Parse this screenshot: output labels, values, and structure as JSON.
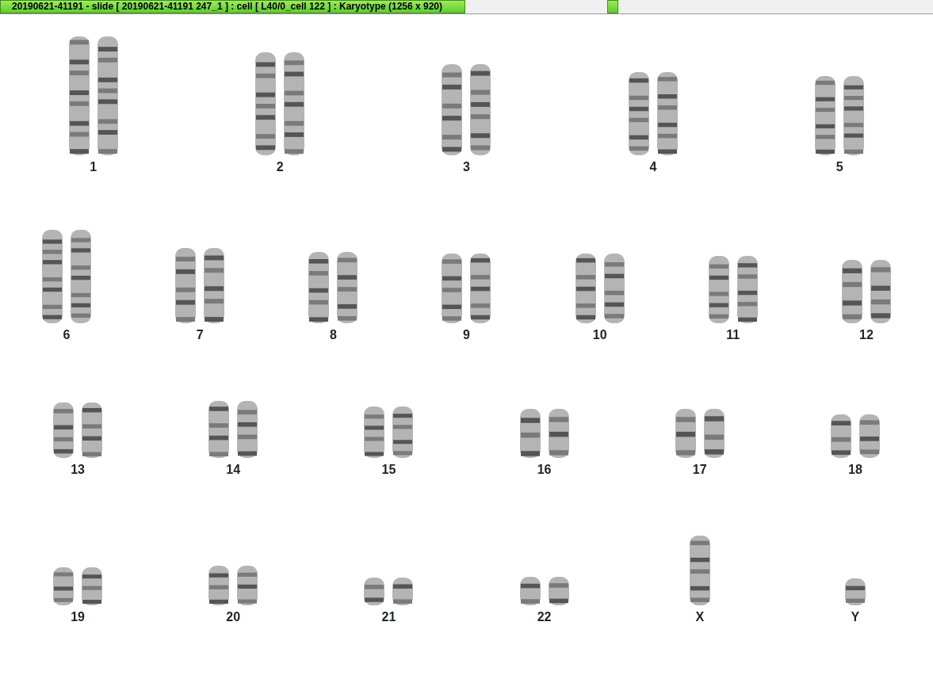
{
  "title_bar": {
    "title": "20190621-41191 - slide [ 20190621-41191 247_1 ] : cell [ L40/0_cell 122 ] : Karyotype  (1256 x 920)"
  },
  "karyotype": {
    "rows": [
      [
        {
          "label": "1",
          "kind": "pair"
        },
        {
          "label": "2",
          "kind": "pair"
        },
        {
          "label": "3",
          "kind": "pair"
        },
        {
          "label": "4",
          "kind": "pair"
        },
        {
          "label": "5",
          "kind": "pair"
        }
      ],
      [
        {
          "label": "6",
          "kind": "pair"
        },
        {
          "label": "7",
          "kind": "pair"
        },
        {
          "label": "8",
          "kind": "pair"
        },
        {
          "label": "9",
          "kind": "pair"
        },
        {
          "label": "10",
          "kind": "pair"
        },
        {
          "label": "11",
          "kind": "pair"
        },
        {
          "label": "12",
          "kind": "pair"
        }
      ],
      [
        {
          "label": "13",
          "kind": "pair"
        },
        {
          "label": "14",
          "kind": "pair"
        },
        {
          "label": "15",
          "kind": "pair"
        },
        {
          "label": "16",
          "kind": "pair"
        },
        {
          "label": "17",
          "kind": "pair"
        },
        {
          "label": "18",
          "kind": "pair"
        }
      ],
      [
        {
          "label": "19",
          "kind": "pair"
        },
        {
          "label": "20",
          "kind": "pair"
        },
        {
          "label": "21",
          "kind": "pair"
        },
        {
          "label": "22",
          "kind": "pair"
        },
        {
          "label": "X",
          "kind": "single"
        },
        {
          "label": "Y",
          "kind": "single"
        }
      ]
    ]
  }
}
